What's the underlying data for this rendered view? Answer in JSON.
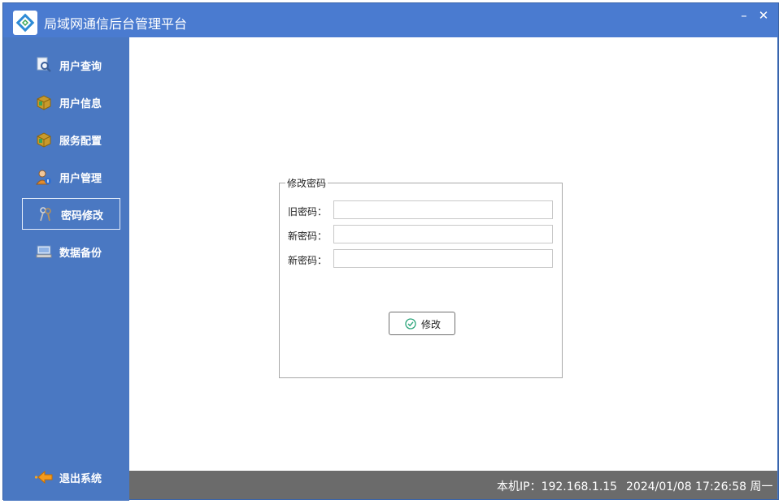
{
  "window": {
    "title": "局域网通信后台管理平台",
    "minimize_label": "–",
    "close_label": "✕"
  },
  "sidebar": {
    "items": [
      {
        "label": "用户查询",
        "icon": "magnifier-page-icon"
      },
      {
        "label": "用户信息",
        "icon": "cube-icon"
      },
      {
        "label": "服务配置",
        "icon": "cube-icon"
      },
      {
        "label": "用户管理",
        "icon": "user-info-icon"
      },
      {
        "label": "密码修改",
        "icon": "keys-icon",
        "active": true
      },
      {
        "label": "数据备份",
        "icon": "computer-icon"
      }
    ],
    "exit_label": "退出系统"
  },
  "password_form": {
    "group_title": "修改密码",
    "old_label": "旧密码：",
    "new_label": "新密码：",
    "confirm_label": "新密码：",
    "old_value": "",
    "new_value": "",
    "confirm_value": "",
    "submit_label": "修改"
  },
  "status": {
    "ip": "本机IP：192.168.1.15",
    "datetime": "2024/01/08 17:26:58 周一"
  },
  "colors": {
    "titlebar": "#4a7bd0",
    "sidebar": "#4a78c2",
    "statusbar": "#6b6b6b",
    "accent": "#ffffff"
  }
}
